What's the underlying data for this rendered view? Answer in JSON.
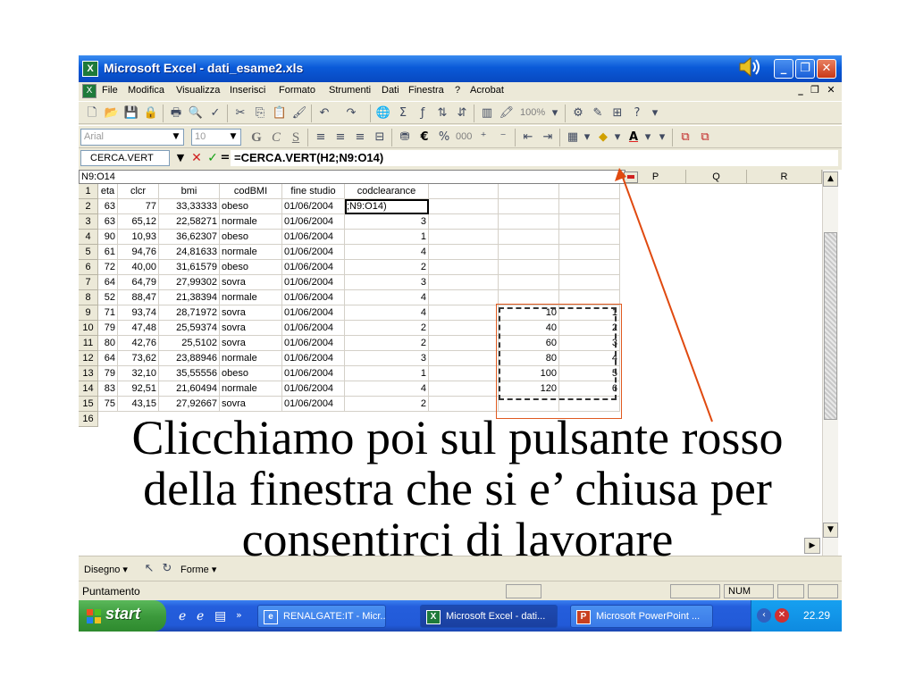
{
  "window": {
    "title": "Microsoft Excel - dati_esame2.xls",
    "app_icon": "X",
    "controls": [
      "_",
      "❐",
      "✕"
    ]
  },
  "menubar": {
    "items": [
      "File",
      "Modifica",
      "Visualizza",
      "Inserisci",
      "Formato",
      "Strumenti",
      "Dati",
      "Finestra",
      "?",
      "Acrobat"
    ],
    "mdi_controls": [
      "_",
      "❐",
      "✕"
    ]
  },
  "toolbar": {
    "zoom": "100%"
  },
  "format_toolbar": {
    "font": "Arial",
    "size": "10",
    "bold": "G",
    "italic": "C",
    "underline": "S",
    "euro": "€",
    "percent": "%",
    "thousands": "000"
  },
  "formula_bar": {
    "name_box": "CERCA.VERT",
    "cancel": "✕",
    "confirm": "✓",
    "equals": "=",
    "formula": "=CERCA.VERT(H2;N9:O14)"
  },
  "sheet": {
    "ref_input": "N9:O14",
    "column_headers": [
      "P",
      "Q",
      "R"
    ],
    "row_numbers": [
      "1",
      "2",
      "3",
      "4",
      "5",
      "6",
      "7",
      "8",
      "9",
      "10",
      "11",
      "12",
      "13",
      "14",
      "15",
      "16"
    ],
    "header_row": [
      "eta",
      "clcr",
      "bmi",
      "codBMI",
      "fine studio",
      "codclearance"
    ],
    "rows": [
      [
        "63",
        "77",
        "33,33333",
        "obeso",
        "01/06/2004",
        ";N9:O14)"
      ],
      [
        "63",
        "65,12",
        "22,58271",
        "normale",
        "01/06/2004",
        "3"
      ],
      [
        "90",
        "10,93",
        "36,62307",
        "obeso",
        "01/06/2004",
        "1"
      ],
      [
        "61",
        "94,76",
        "24,81633",
        "normale",
        "01/06/2004",
        "4"
      ],
      [
        "72",
        "40,00",
        "31,61579",
        "obeso",
        "01/06/2004",
        "2"
      ],
      [
        "64",
        "64,79",
        "27,99302",
        "sovra",
        "01/06/2004",
        "3"
      ],
      [
        "52",
        "88,47",
        "21,38394",
        "normale",
        "01/06/2004",
        "4"
      ],
      [
        "71",
        "93,74",
        "28,71972",
        "sovra",
        "01/06/2004",
        "4"
      ],
      [
        "79",
        "47,48",
        "25,59374",
        "sovra",
        "01/06/2004",
        "2"
      ],
      [
        "80",
        "42,76",
        "25,5102",
        "sovra",
        "01/06/2004",
        "2"
      ],
      [
        "64",
        "73,62",
        "23,88946",
        "normale",
        "01/06/2004",
        "3"
      ],
      [
        "79",
        "32,10",
        "35,55556",
        "obeso",
        "01/06/2004",
        "1"
      ],
      [
        "83",
        "92,51",
        "21,60494",
        "normale",
        "01/06/2004",
        "4"
      ],
      [
        "75",
        "43,15",
        "27,92667",
        "sovra",
        "01/06/2004",
        "2"
      ]
    ],
    "lookup_table": [
      [
        "10",
        "1"
      ],
      [
        "40",
        "2"
      ],
      [
        "60",
        "3"
      ],
      [
        "80",
        "4"
      ],
      [
        "100",
        "5"
      ],
      [
        "120",
        "6"
      ]
    ]
  },
  "drawing_toolbar": {
    "draw_label": "Disegno ▾",
    "shapes_label": "Forme ▾"
  },
  "statusbar": {
    "mode": "Puntamento",
    "num": "NUM"
  },
  "taskbar": {
    "start_label": "start",
    "tasks": [
      "RENALGATE:IT - Micr...",
      "Microsoft Excel - dati...",
      "Microsoft PowerPoint ..."
    ],
    "clock": "22.29"
  },
  "caption": {
    "line1": "Clicchiamo poi sul pulsante rosso",
    "line2": "della finestra che si e’ chiusa per",
    "line3": "consentirci di lavorare"
  },
  "colors": {
    "titlebar": "#0a5ad8",
    "highlight": "#e05a20",
    "start_button": "#3c9a3c"
  }
}
